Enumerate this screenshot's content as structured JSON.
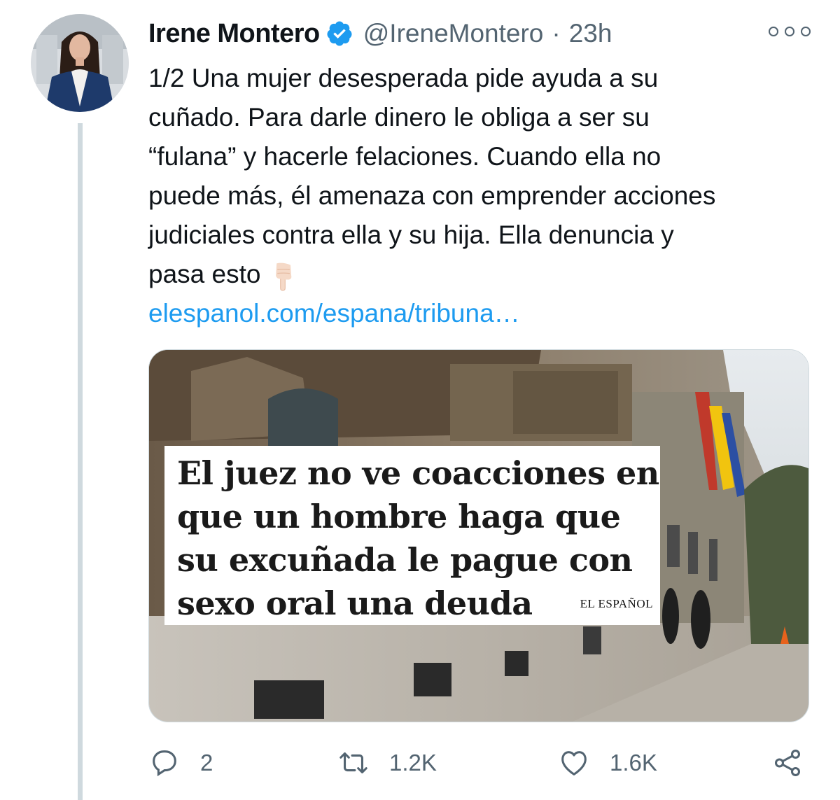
{
  "tweet": {
    "author": {
      "name": "Irene Montero",
      "handle": "@IreneMontero",
      "verified": true
    },
    "separator": "·",
    "time": "23h",
    "text_lines": [
      "1/2 Una mujer desesperada pide ayuda a su",
      "cuñado. Para darle dinero le obliga a ser su",
      "“fulana” y hacerle felaciones. Cuando ella no",
      "puede más, él amenaza con emprender acciones",
      "judiciales contra ella y su hija. Ella denuncia y",
      "pasa esto"
    ],
    "emoji": "backhand-index-pointing-down",
    "link": "elespanol.com/espana/tribuna…",
    "media": {
      "headline_lines": [
        "El juez no ve coacciones en",
        "que un hombre haga que",
        "su excuñada le pague con",
        "sexo oral una deuda"
      ],
      "logo_text": "EL ESPAÑOL"
    },
    "actions": {
      "replies": "2",
      "retweets": "1.2K",
      "likes": "1.6K"
    }
  },
  "colors": {
    "link": "#1d9bf0",
    "verified": "#1d9bf0",
    "secondary_text": "#536471",
    "thread_line": "#cfd9de"
  },
  "icons": [
    "verified-badge-icon",
    "more-icon",
    "reply-icon",
    "retweet-icon",
    "like-icon",
    "share-icon"
  ]
}
